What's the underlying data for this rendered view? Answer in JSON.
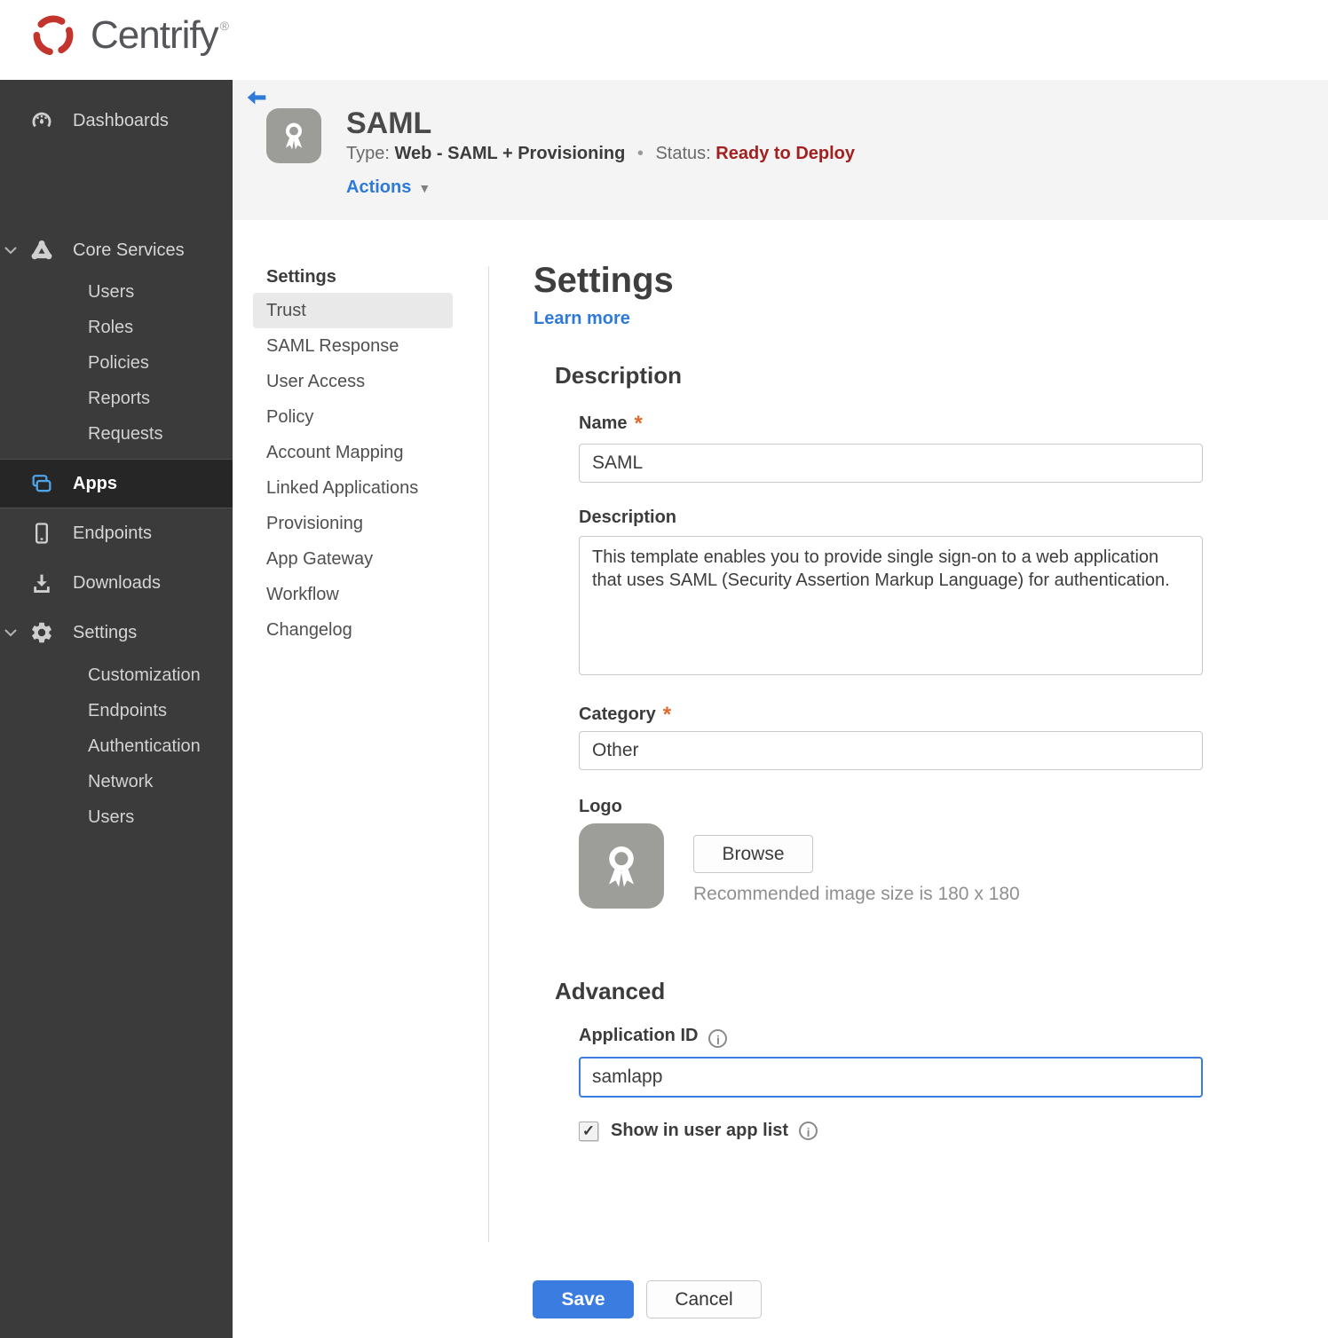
{
  "brand": {
    "name": "Centrify",
    "registered": "®",
    "logo_color": "#c3342c"
  },
  "icons": {
    "checkmark": "✓",
    "info": "i",
    "caret_down": "▼",
    "dot_separator": "•",
    "required_asterisk": "*"
  },
  "colors": {
    "accent_blue": "#2e7ad8",
    "save_blue": "#3b7ce0",
    "status_red": "#a32020",
    "brand_red": "#c3342c",
    "sidebar_bg": "#3b3b3b",
    "sidebar_active_bg": "#262626",
    "header_strip_bg": "#f4f4f4",
    "required_orange": "#e06a2b"
  },
  "sidebar": {
    "items": [
      {
        "label": "Dashboards"
      },
      {
        "label": "Core Services",
        "expanded": true,
        "children": [
          "Users",
          "Roles",
          "Policies",
          "Reports",
          "Requests"
        ]
      },
      {
        "label": "Apps",
        "active": true
      },
      {
        "label": "Endpoints"
      },
      {
        "label": "Downloads"
      },
      {
        "label": "Settings",
        "expanded": true,
        "children": [
          "Customization",
          "Endpoints",
          "Authentication",
          "Network",
          "Users"
        ]
      }
    ]
  },
  "app_header": {
    "title": "SAML",
    "type_label": "Type:",
    "type_value": "Web - SAML + Provisioning",
    "status_label": "Status:",
    "status_value": "Ready to Deploy",
    "actions_label": "Actions"
  },
  "subnav": {
    "heading": "Settings",
    "selected": "Trust",
    "items": [
      "Trust",
      "SAML Response",
      "User Access",
      "Policy",
      "Account Mapping",
      "Linked Applications",
      "Provisioning",
      "App Gateway",
      "Workflow",
      "Changelog"
    ]
  },
  "main": {
    "title": "Settings",
    "learn_more": "Learn more",
    "description_section": {
      "heading": "Description",
      "name_label": "Name",
      "name_value": "SAML",
      "description_label": "Description",
      "description_value": "This template enables you to provide single sign-on to a web application that uses SAML (Security Assertion Markup Language) for authentication.",
      "category_label": "Category",
      "category_value": "Other",
      "logo_label": "Logo",
      "browse_label": "Browse",
      "logo_hint": "Recommended image size is 180 x 180"
    },
    "advanced_section": {
      "heading": "Advanced",
      "app_id_label": "Application ID",
      "app_id_value": "samlapp",
      "show_in_app_list_label": "Show in user app list",
      "show_in_app_list_checked": true
    },
    "buttons": {
      "save": "Save",
      "cancel": "Cancel"
    }
  }
}
